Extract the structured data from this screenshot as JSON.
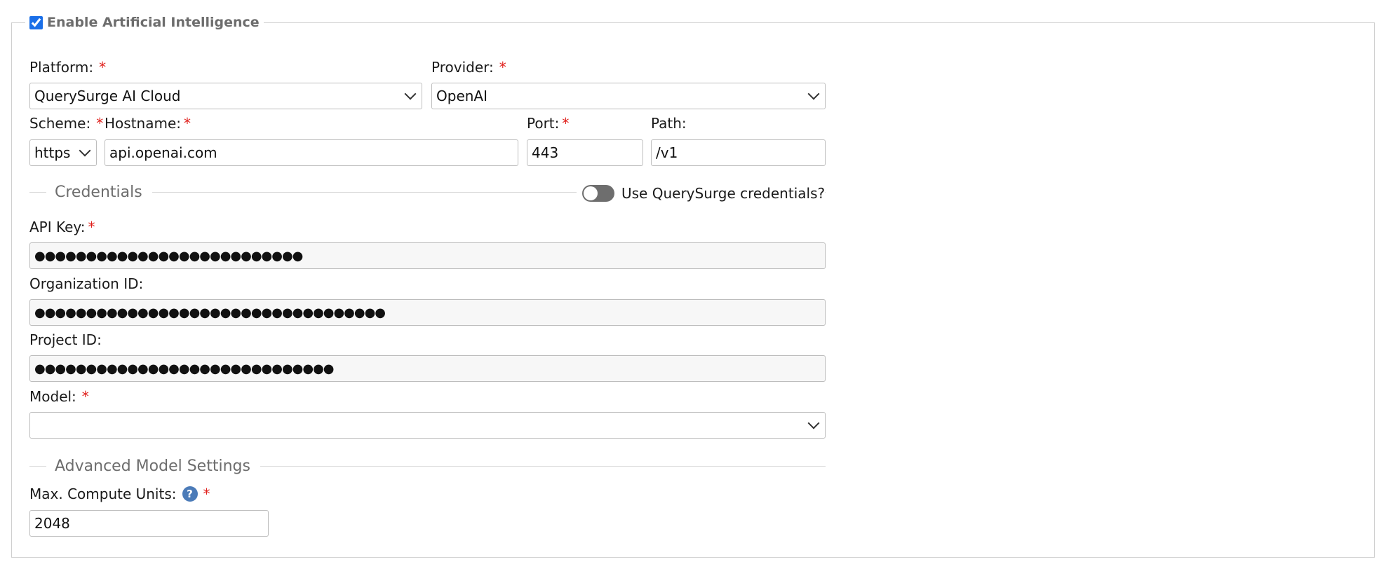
{
  "enable_ai": {
    "label": "Enable Artificial Intelligence",
    "checked": true
  },
  "platform": {
    "label": "Platform:",
    "value": "QuerySurge AI Cloud"
  },
  "provider": {
    "label": "Provider:",
    "value": "OpenAI"
  },
  "scheme": {
    "label": "Scheme:",
    "value": "https"
  },
  "hostname": {
    "label": "Hostname:",
    "value": "api.openai.com"
  },
  "port": {
    "label": "Port:",
    "value": "443"
  },
  "path": {
    "label": "Path:",
    "value": "/v1"
  },
  "credentials": {
    "title": "Credentials",
    "toggle_label": "Use QuerySurge credentials?",
    "toggle_on": false
  },
  "api_key": {
    "label": "API Key:",
    "masked": "●●●●●●●●●●●●●●●●●●●●●●●●●●"
  },
  "org_id": {
    "label": "Organization ID:",
    "masked": "●●●●●●●●●●●●●●●●●●●●●●●●●●●●●●●●●●"
  },
  "project_id": {
    "label": "Project ID:",
    "masked": "●●●●●●●●●●●●●●●●●●●●●●●●●●●●●"
  },
  "model": {
    "label": "Model:",
    "value": ""
  },
  "advanced": {
    "title": "Advanced Model Settings"
  },
  "max_compute": {
    "label": "Max. Compute Units:",
    "value": "2048",
    "help_glyph": "?"
  },
  "required_mark": "*",
  "colors": {
    "required": "#e0201c",
    "accent": "#1a6fe8",
    "help": "#4b7bb8"
  }
}
